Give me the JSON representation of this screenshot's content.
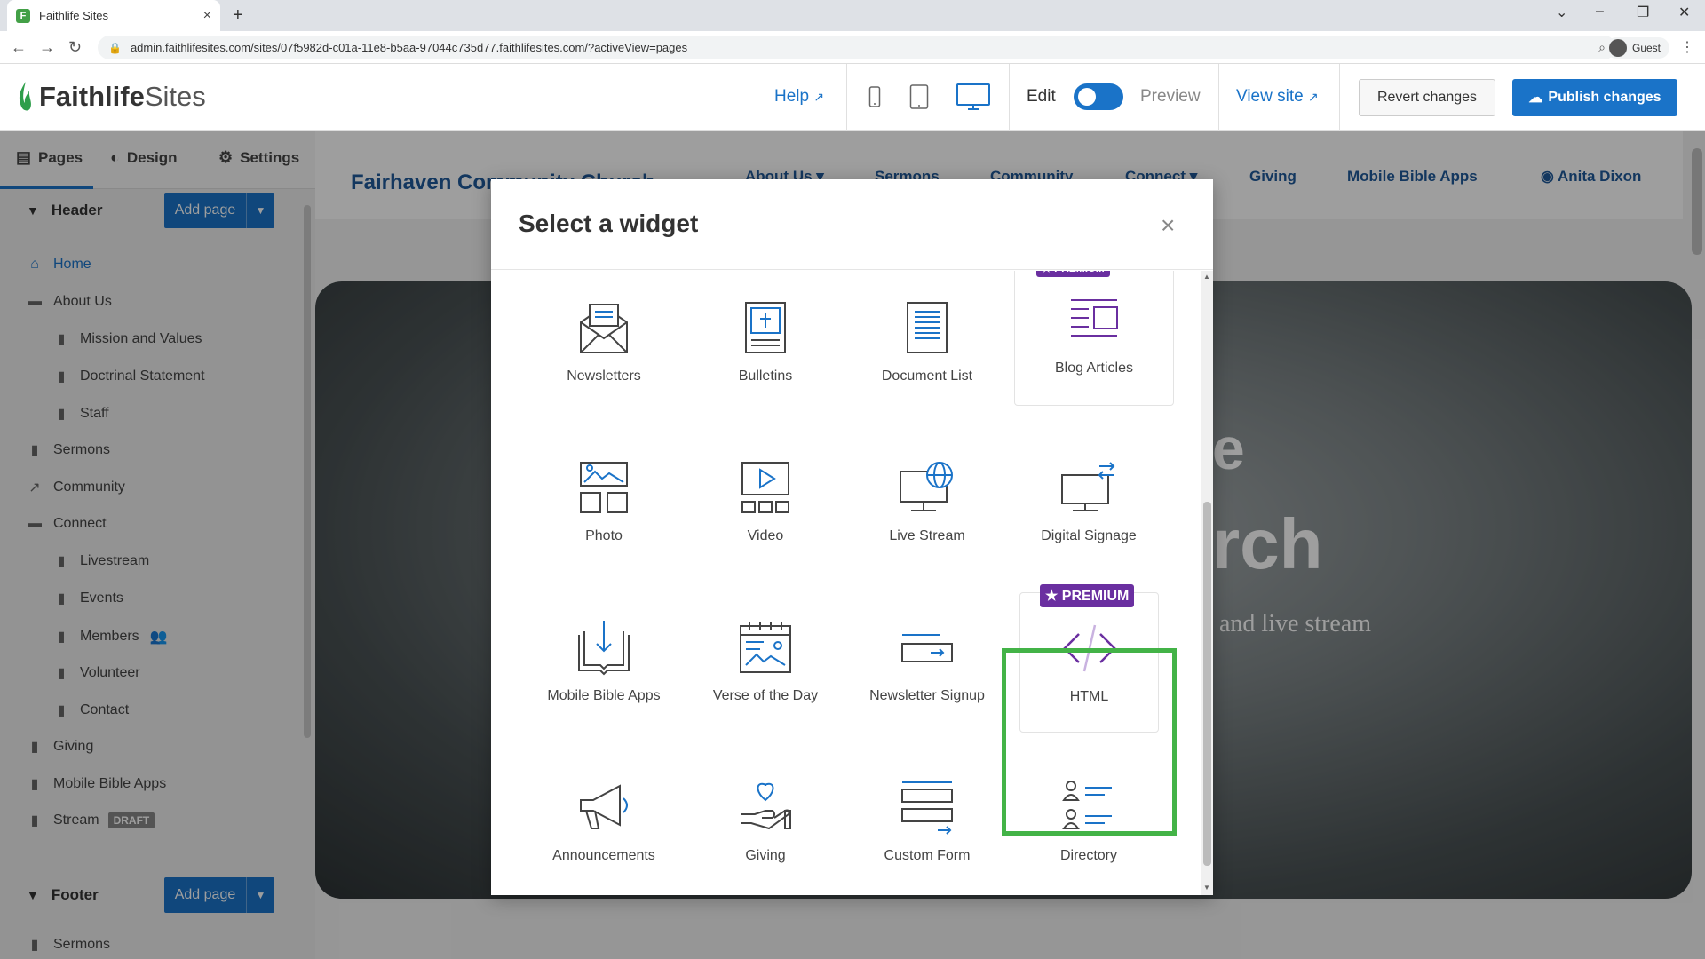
{
  "browser": {
    "tab_title": "Faithlife Sites",
    "tab_close": "×",
    "new_tab": "+",
    "url": "admin.faithlifesites.com/sites/07f5982d-c01a-11e8-b5aa-97044c735d77.faithlifesites.com/?activeView=pages",
    "profile_label": "Guest",
    "back_glyph": "←",
    "forward_glyph": "→",
    "reload_glyph": "↻",
    "min_glyph": "–",
    "max_glyph": "❐",
    "close_glyph": "✕",
    "tabsearch_glyph": "⌄",
    "menu_glyph": "⋮"
  },
  "header": {
    "logo_bold": "Faithlife",
    "logo_light": " Sites",
    "help": "Help",
    "edit": "Edit",
    "preview": "Preview",
    "view_site": "View site",
    "revert": "Revert changes",
    "publish": "Publish changes",
    "accent": "#1a73c8"
  },
  "sidebar": {
    "tabs": [
      {
        "label": "Pages",
        "icon": "document-icon"
      },
      {
        "label": "Design",
        "icon": "palette-icon"
      },
      {
        "label": "Settings",
        "icon": "gear-icon"
      }
    ],
    "header_section": "Header",
    "footer_section": "Footer",
    "add_page": "Add page",
    "pages": [
      {
        "label": "Home",
        "icon": "home-icon"
      },
      {
        "label": "About Us",
        "icon": "folder-icon"
      },
      {
        "label": "Mission and Values",
        "icon": "page-icon"
      },
      {
        "label": "Doctrinal Statement",
        "icon": "page-icon"
      },
      {
        "label": "Staff",
        "icon": "page-icon"
      },
      {
        "label": "Sermons",
        "icon": "page-icon"
      },
      {
        "label": "Community",
        "icon": "external-link-icon"
      },
      {
        "label": "Connect",
        "icon": "folder-icon"
      },
      {
        "label": "Livestream",
        "icon": "page-icon"
      },
      {
        "label": "Events",
        "icon": "page-icon"
      },
      {
        "label": "Members",
        "icon": "page-icon"
      },
      {
        "label": "Volunteer",
        "icon": "page-icon"
      },
      {
        "label": "Contact",
        "icon": "page-icon"
      },
      {
        "label": "Giving",
        "icon": "page-icon"
      },
      {
        "label": "Mobile Bible Apps",
        "icon": "page-icon"
      },
      {
        "label": "Stream",
        "icon": "page-icon",
        "badge": "DRAFT"
      }
    ],
    "footer_pages": [
      {
        "label": "Sermons",
        "icon": "page-icon"
      }
    ]
  },
  "site": {
    "title": "Fairhaven Community Church",
    "nav": [
      "About Us ▾",
      "Sermons",
      "Community",
      "Connect ▾",
      "Giving",
      "Mobile Bible Apps"
    ],
    "user": "Anita Dixon",
    "hero_line1": "e",
    "hero_line2": "rch",
    "hero_line3": "and live stream"
  },
  "modal": {
    "title": "Select a widget",
    "close": "×",
    "premium_label": "★ PREMIUM",
    "widgets": [
      {
        "label": "Newsletters",
        "icon": "envelope-icon"
      },
      {
        "label": "Bulletins",
        "icon": "bulletin-icon"
      },
      {
        "label": "Document List",
        "icon": "document-list-icon"
      },
      {
        "label": "Blog Articles",
        "icon": "blog-icon",
        "premium": true
      },
      {
        "label": "Photo",
        "icon": "photo-icon"
      },
      {
        "label": "Video",
        "icon": "video-icon"
      },
      {
        "label": "Live Stream",
        "icon": "live-stream-icon"
      },
      {
        "label": "Digital Signage",
        "icon": "digital-signage-icon"
      },
      {
        "label": "Mobile Bible Apps",
        "icon": "bible-download-icon"
      },
      {
        "label": "Verse of the Day",
        "icon": "calendar-verse-icon"
      },
      {
        "label": "Newsletter Signup",
        "icon": "signup-icon"
      },
      {
        "label": "HTML",
        "icon": "code-icon",
        "premium": true,
        "highlighted": true
      },
      {
        "label": "Announcements",
        "icon": "megaphone-icon"
      },
      {
        "label": "Giving",
        "icon": "giving-icon"
      },
      {
        "label": "Custom Form",
        "icon": "form-icon"
      },
      {
        "label": "Directory",
        "icon": "directory-icon"
      }
    ],
    "highlight_color": "#43b347",
    "premium_color": "#6a2fa0"
  }
}
